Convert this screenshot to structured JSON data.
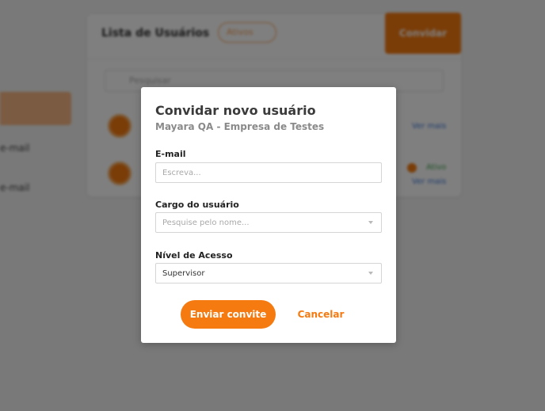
{
  "background": {
    "card_title": "Lista de Usuários",
    "filter_label": "Ativos",
    "invite_button": "Convidar",
    "search_placeholder": "Pesquisar",
    "sidebar_items": [
      "e-mail",
      "e-mail"
    ],
    "row_links": [
      "Ver mais",
      "Ver mais"
    ],
    "row_tag": "Ativo"
  },
  "modal": {
    "title": "Convidar novo usuário",
    "subtitle": "Mayara QA - Empresa de Testes",
    "email": {
      "label": "E-mail",
      "value": "",
      "placeholder": "Escreva..."
    },
    "role": {
      "label": "Cargo do usuário",
      "placeholder": "Pesquise pelo nome...",
      "icon": "chevron-down-icon"
    },
    "access": {
      "label": "Nível de Acesso",
      "value": "Supervisor",
      "icon": "chevron-down-icon"
    },
    "submit_label": "Enviar convite",
    "cancel_label": "Cancelar"
  },
  "colors": {
    "accent": "#f57a10",
    "overlay": "rgba(0,0,0,0.5)",
    "text_primary": "#3b3b3b",
    "text_secondary": "#8a8a8a"
  }
}
